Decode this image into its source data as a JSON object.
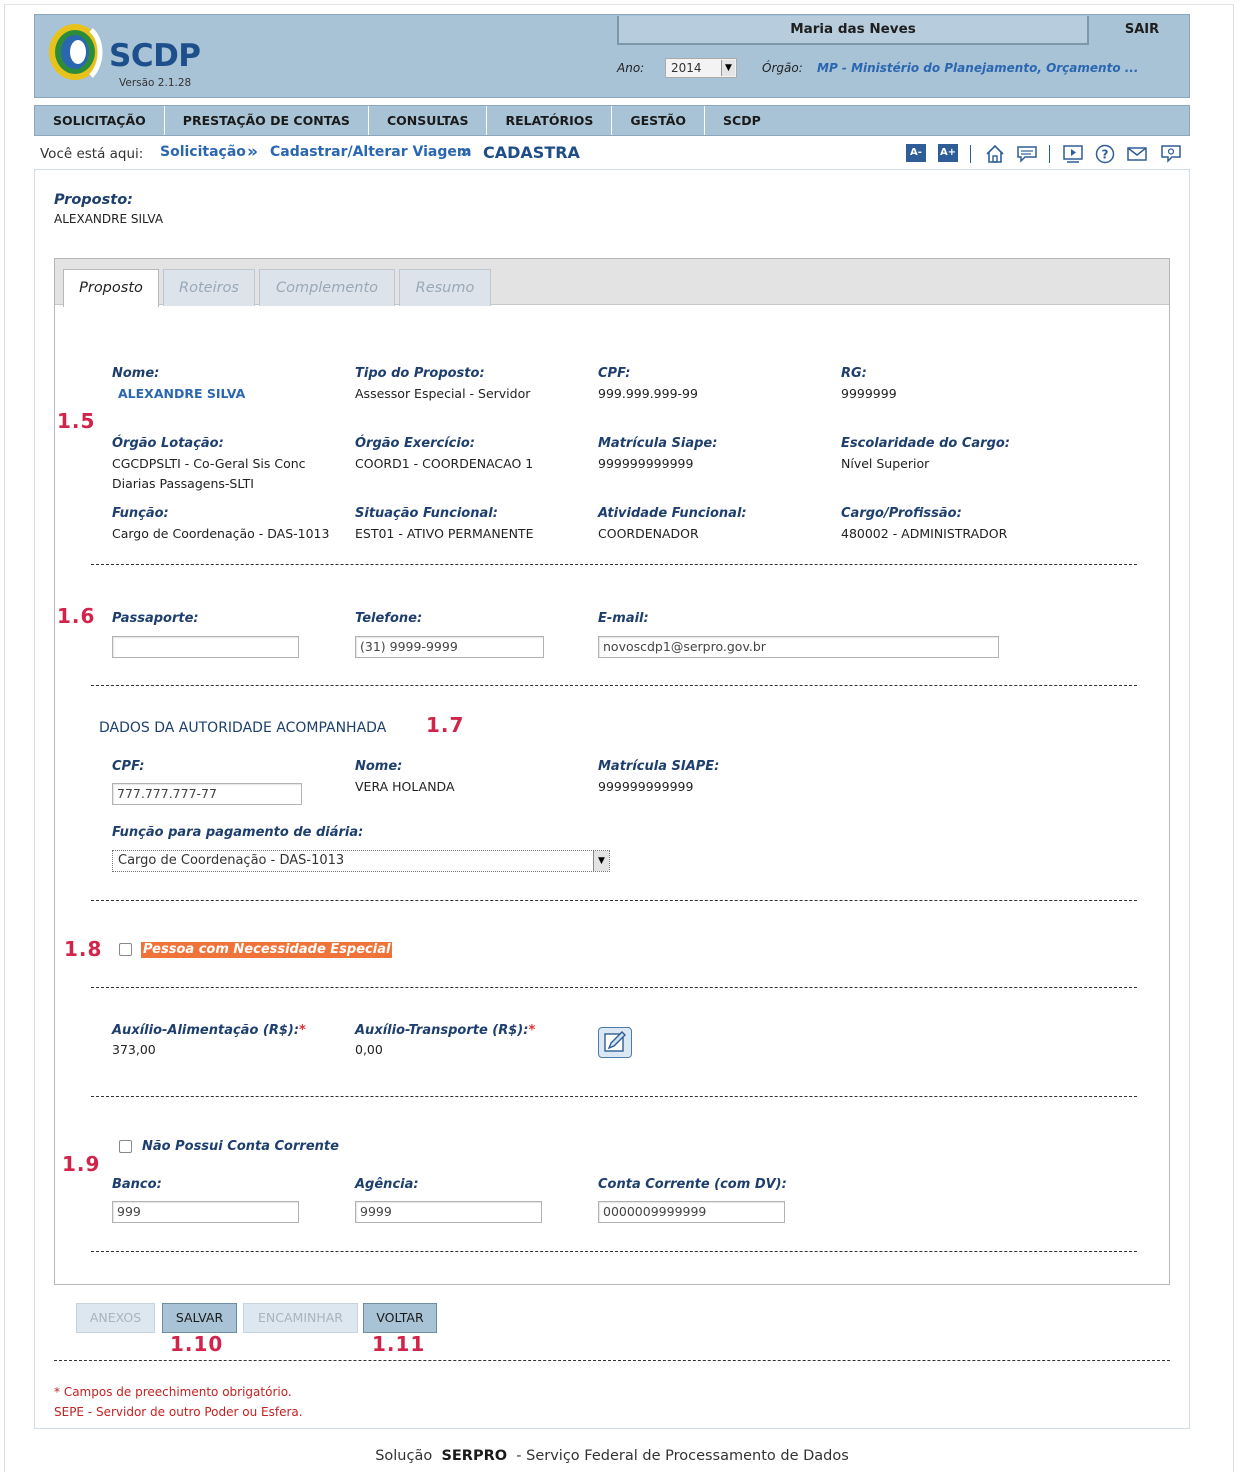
{
  "header": {
    "app_name": "SCDP",
    "version": "Versão 2.1.28",
    "user_name": "Maria das Neves",
    "logout_label": "SAIR",
    "ano_label": "Ano:",
    "ano_value": "2014",
    "orgao_label": "Órgão:",
    "orgao_value": "MP - Ministério do Planejamento, Orçamento ..."
  },
  "menu": {
    "items": [
      {
        "label": "SOLICITAÇÃO"
      },
      {
        "label": "PRESTAÇÃO DE CONTAS"
      },
      {
        "label": "CONSULTAS"
      },
      {
        "label": "RELATÓRIOS"
      },
      {
        "label": "GESTÃO"
      },
      {
        "label": "SCDP"
      }
    ]
  },
  "breadcrumb": {
    "prefix": "Você está aqui:",
    "items": [
      "Solicitação",
      "Cadastrar/Alterar Viagem",
      "CADASTRA"
    ]
  },
  "toolbar": {
    "font_decrease": "A-",
    "font_increase": "A+",
    "icons": [
      "home-icon",
      "chat-icon",
      "video-icon",
      "help-icon",
      "mail-icon",
      "feedback-icon"
    ]
  },
  "proposto_header": {
    "title": "Proposto:",
    "name": "ALEXANDRE SILVA"
  },
  "tabs": [
    {
      "label": "Proposto",
      "active": true
    },
    {
      "label": "Roteiros",
      "active": false
    },
    {
      "label": "Complemento",
      "active": false
    },
    {
      "label": "Resumo",
      "active": false
    }
  ],
  "section_numbers": {
    "s1_5": "1.5",
    "s1_6": "1.6",
    "s1_7": "1.7",
    "s1_8": "1.8",
    "s1_9": "1.9",
    "s1_10": "1.10",
    "s1_11": "1.11"
  },
  "proposto": {
    "nome_label": "Nome:",
    "nome": "ALEXANDRE SILVA",
    "tipo_label": "Tipo do Proposto:",
    "tipo": "Assessor Especial - Servidor",
    "cpf_label": "CPF:",
    "cpf": "999.999.999-99",
    "rg_label": "RG:",
    "rg": "9999999",
    "orgao_lotacao_label": "Órgão Lotação:",
    "orgao_lotacao_1": "CGCDPSLTI - Co-Geral Sis Conc",
    "orgao_lotacao_2": "Diarias Passagens-SLTI",
    "orgao_exercicio_label": "Órgão Exercício:",
    "orgao_exercicio": "COORD1 - COORDENACAO 1",
    "matricula_label": "Matrícula Siape:",
    "matricula": "999999999999",
    "escolaridade_label": "Escolaridade do Cargo:",
    "escolaridade": "Nível Superior",
    "funcao_label": "Função:",
    "funcao": "Cargo de Coordenação - DAS-1013",
    "situacao_label": "Situação Funcional:",
    "situacao": "EST01 - ATIVO PERMANENTE",
    "atividade_label": "Atividade Funcional:",
    "atividade": "COORDENADOR",
    "cargo_label": "Cargo/Profissão:",
    "cargo": "480002 - ADMINISTRADOR"
  },
  "contato": {
    "passaporte_label": "Passaporte:",
    "passaporte": "",
    "telefone_label": "Telefone:",
    "telefone": "(31) 9999-9999",
    "email_label": "E-mail:",
    "email": "novoscdp1@serpro.gov.br"
  },
  "autoridade": {
    "title": "DADOS DA AUTORIDADE ACOMPANHADA",
    "cpf_label": "CPF:",
    "cpf": "777.777.777-77",
    "nome_label": "Nome:",
    "nome": "VERA HOLANDA",
    "matricula_label": "Matrícula SIAPE:",
    "matricula": "999999999999",
    "funcao_label": "Função para pagamento de diária:",
    "funcao": "Cargo de Coordenação - DAS-1013"
  },
  "necessidade": {
    "label": "Pessoa com Necessidade Especial",
    "checked": false
  },
  "auxilios": {
    "alimentacao_label": "Auxílio-Alimentação (R$):",
    "alimentacao": "373,00",
    "transporte_label": "Auxílio-Transporte (R$):",
    "transporte": "0,00",
    "required_mark": "*"
  },
  "banco": {
    "sem_conta_label": "Não Possui Conta Corrente",
    "banco_label": "Banco:",
    "banco": "999",
    "agencia_label": "Agência:",
    "agencia": "9999",
    "conta_label": "Conta Corrente (com DV):",
    "conta": "0000009999999"
  },
  "buttons": {
    "anexos": "ANEXOS",
    "salvar": "SALVAR",
    "encaminhar": "ENCAMINHAR",
    "voltar": "VOLTAR"
  },
  "notes": {
    "obrigatorio": "* Campos de preechimento obrigatório.",
    "sepe": "SEPE - Servidor de outro Poder ou Esfera."
  },
  "footer": {
    "prefix": "Solução",
    "brand": "SERPRO",
    "suffix": "- Serviço Federal de Processamento de Dados"
  },
  "colors": {
    "header_bg": "#a9c3d6",
    "label_blue": "#1e3f6e",
    "link_blue": "#2a67b0",
    "section_red": "#d2234a",
    "special_orange": "#f0733a"
  }
}
